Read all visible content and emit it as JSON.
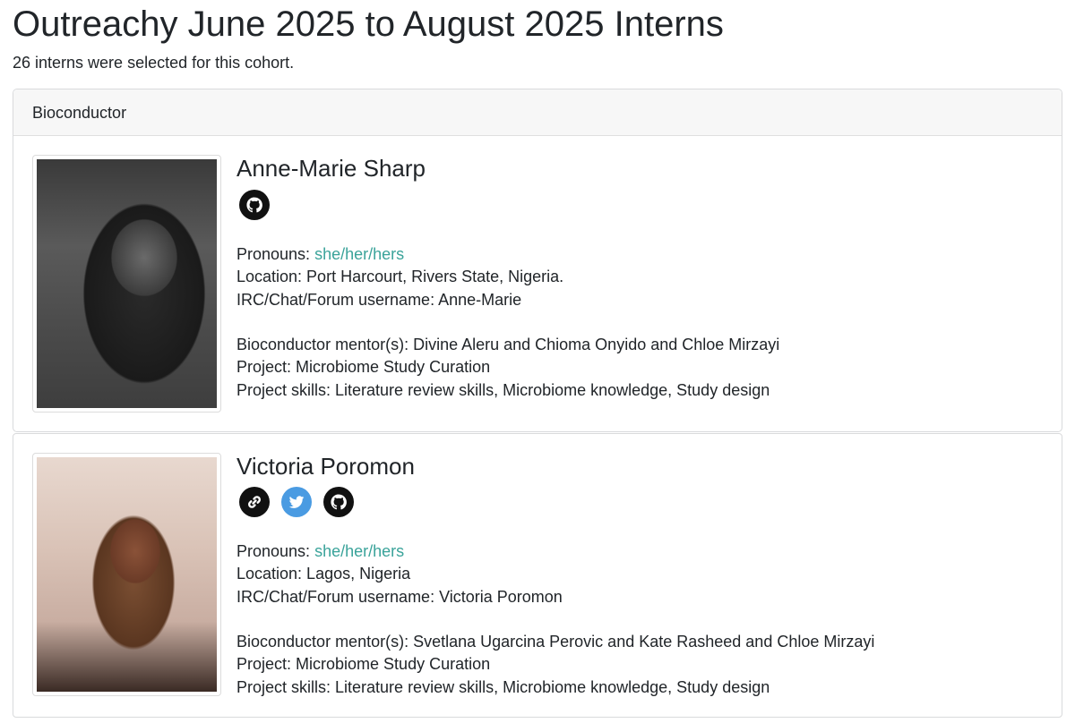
{
  "page": {
    "title": "Outreachy June 2025 to August 2025 Interns",
    "subtitle": "26 interns were selected for this cohort."
  },
  "section": {
    "header": "Bioconductor"
  },
  "interns": [
    {
      "name": "Anne-Marie Sharp",
      "icons": [
        "github-icon"
      ],
      "pronouns_label": "Pronouns: ",
      "pronouns": "she/her/hers",
      "location": "Location: Port Harcourt, Rivers State, Nigeria.",
      "username": "IRC/Chat/Forum username: Anne-Marie",
      "mentors": "Bioconductor mentor(s): Divine Aleru and Chioma Onyido and Chloe Mirzayi",
      "project": "Project: Microbiome Study Curation",
      "skills": "Project skills: Literature review skills, Microbiome knowledge, Study design"
    },
    {
      "name": "Victoria Poromon",
      "icons": [
        "link-icon",
        "twitter-icon",
        "github-icon"
      ],
      "pronouns_label": "Pronouns: ",
      "pronouns": "she/her/hers",
      "location": "Location: Lagos, Nigeria",
      "username": "IRC/Chat/Forum username: Victoria Poromon",
      "mentors": "Bioconductor mentor(s): Svetlana Ugarcina Perovic and Kate Rasheed and Chloe Mirzayi",
      "project": "Project: Microbiome Study Curation",
      "skills": "Project skills: Literature review skills, Microbiome knowledge, Study design"
    }
  ],
  "colors": {
    "link": "#3aa39a",
    "twitter": "#4a9be2",
    "text": "#212529",
    "header_bg": "#f7f7f7"
  }
}
